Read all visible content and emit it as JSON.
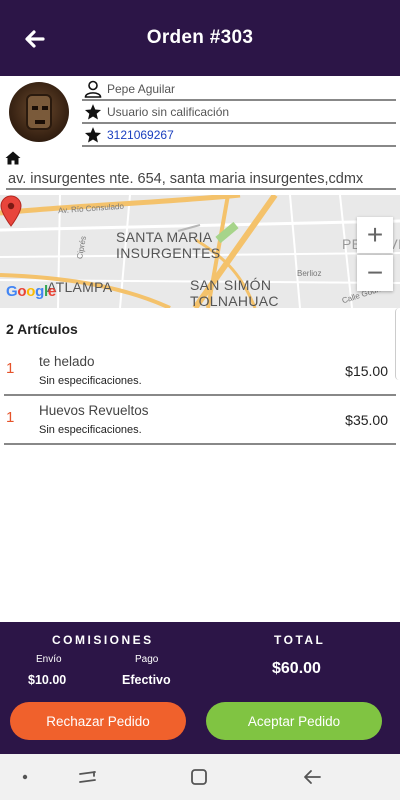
{
  "header": {
    "title": "Orden #303",
    "back_icon": "arrow-left-icon"
  },
  "customer": {
    "name": "Pepe Aguilar",
    "rating": "Usuario sin calificación",
    "phone": "3121069267"
  },
  "address": "av. insurgentes nte. 654, santa maria insurgentes,cdmx",
  "map": {
    "labels": {
      "area1_line1": "SANTA MARIA",
      "area1_line2": "INSURGENTES",
      "area2_line1": "SAN SIMÓN",
      "area2_line2": "TOLNAHUAC",
      "area3": "ATLAMPA",
      "area4": "PERALVI",
      "street1": "Av. Río Consulado",
      "street2": "Berlioz",
      "street3": "Calle Gounod",
      "street4": "Ciprés"
    },
    "attribution": "Google",
    "zoom_in": "+",
    "zoom_out": "−"
  },
  "items_title": "2 Artículos",
  "items": [
    {
      "qty": "1",
      "name": "te helado",
      "spec": "Sin especificaciones.",
      "price": "$15.00"
    },
    {
      "qty": "1",
      "name": "Huevos Revueltos",
      "spec": "Sin especificaciones.",
      "price": "$35.00"
    }
  ],
  "footer": {
    "commissions_label": "COMISIONES",
    "shipping_label": "Envío",
    "shipping_value": "$10.00",
    "payment_label": "Pago",
    "payment_value": "Efectivo",
    "total_label": "TOTAL",
    "total_value": "$60.00",
    "reject_label": "Rechazar Pedido",
    "accept_label": "Aceptar Pedido"
  },
  "colors": {
    "primary": "#2c1547",
    "reject": "#f0612c",
    "accept": "#80c442",
    "qty": "#e5532a",
    "link": "#1a3fbf"
  }
}
